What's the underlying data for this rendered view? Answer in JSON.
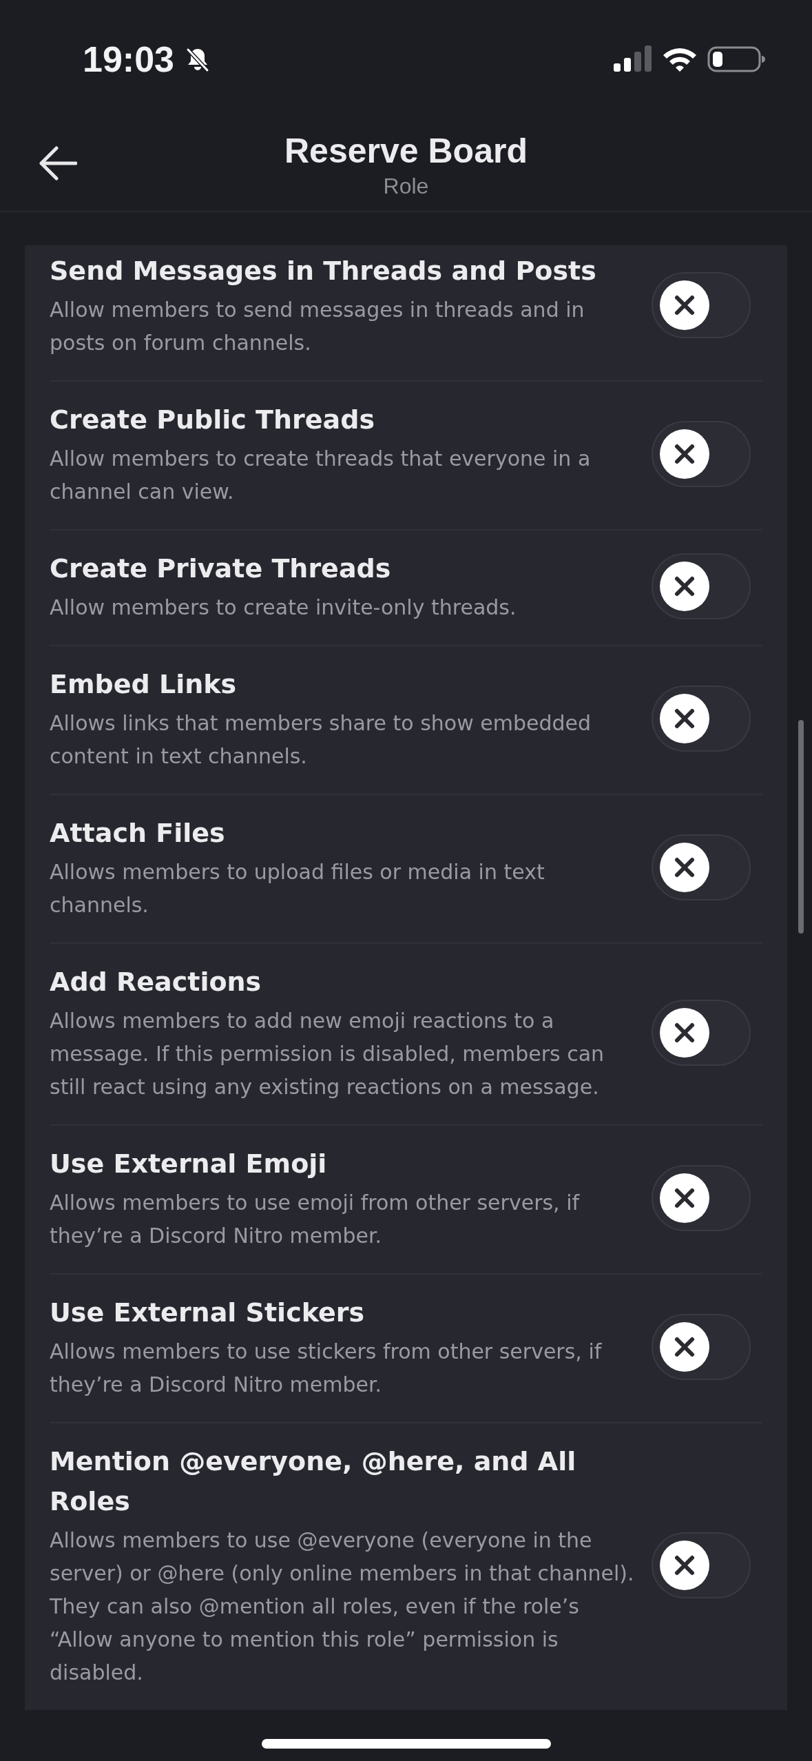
{
  "status_bar": {
    "time": "19:03"
  },
  "header": {
    "title": "Reserve Board",
    "subtitle": "Role"
  },
  "permissions": [
    {
      "title": "Send Messages in Threads and Posts",
      "description": "Allow members to send messages in threads and in posts on forum channels.",
      "on": false
    },
    {
      "title": "Create Public Threads",
      "description": "Allow members to create threads that everyone in a channel can view.",
      "on": false
    },
    {
      "title": "Create Private Threads",
      "description": "Allow members to create invite-only threads.",
      "on": false
    },
    {
      "title": "Embed Links",
      "description": "Allows links that members share to show embedded content in text channels.",
      "on": false
    },
    {
      "title": "Attach Files",
      "description": "Allows members to upload files or media in text channels.",
      "on": false
    },
    {
      "title": "Add Reactions",
      "description": "Allows members to add new emoji reactions to a message. If this permission is disabled, members can still react using any existing reactions on a message.",
      "on": false
    },
    {
      "title": "Use External Emoji",
      "description": "Allows members to use emoji from other servers, if they’re a Discord Nitro member.",
      "on": false
    },
    {
      "title": "Use External Stickers",
      "description": "Allows members to use stickers from other servers, if they’re a Discord Nitro member.",
      "on": false
    },
    {
      "title": "Mention @everyone, @here, and All Roles",
      "description": "Allows members to use @everyone (everyone in the server) or @here (only online members in that channel). They can also @mention all roles, even if the role’s “Allow anyone to mention this role” permission is disabled.",
      "on": false
    }
  ]
}
